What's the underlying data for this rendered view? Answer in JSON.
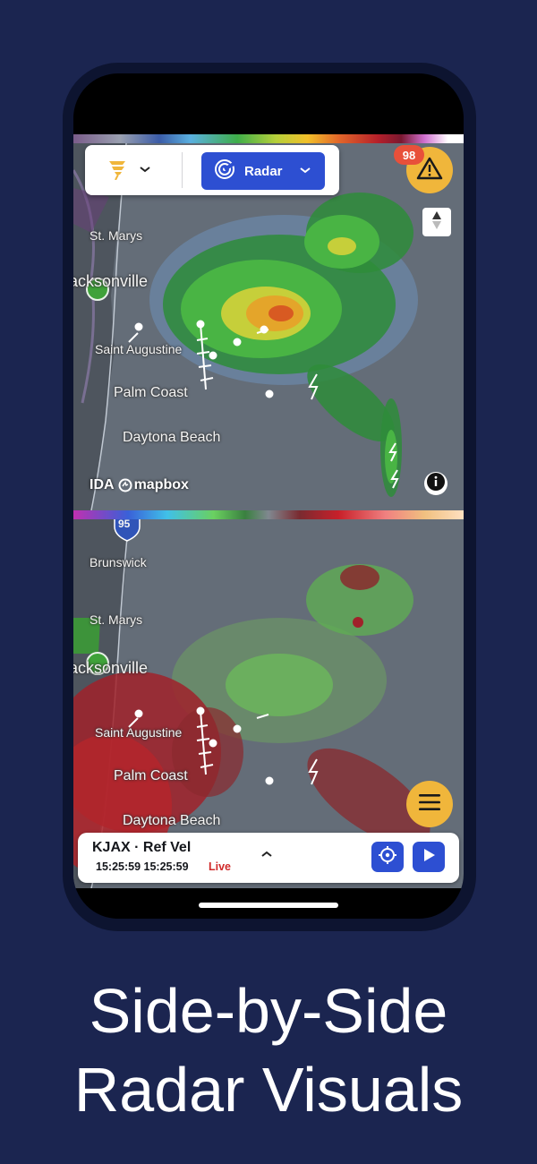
{
  "colors": {
    "background": "#1b2550",
    "accent_blue": "#2d4fd2",
    "alert_yellow": "#f0b63b",
    "badge_red": "#e8503a",
    "live_red": "#d02a2a",
    "city_marker_green": "#3fa23a"
  },
  "toolbar": {
    "layer_icon": "storm-layer-icon",
    "radar_icon": "radar-icon",
    "radar_label": "Radar"
  },
  "alerts": {
    "count": "98",
    "icon": "warning-triangle-icon"
  },
  "compass": {
    "icon": "compass-north-icon"
  },
  "info": {
    "icon": "info-icon"
  },
  "attribution": {
    "brand": "mapbox",
    "overlay_fragment": "IDA"
  },
  "map_top": {
    "cities": [
      "St. Marys",
      "Jacksonville",
      "Saint Augustine",
      "Palm Coast",
      "Daytona Beach",
      "Daytona"
    ]
  },
  "map_bottom": {
    "interstate_shield": "95",
    "cities": [
      "Brunswick",
      "St. Marys",
      "Jacksonville",
      "Saint Augustine",
      "Palm Coast",
      "Daytona Beach"
    ]
  },
  "menu": {
    "icon": "hamburger-menu-icon"
  },
  "bottom_panel": {
    "station": "KJAX · Ref Vel",
    "times": "15:25:59 15:25:59",
    "live": "Live",
    "expand_icon": "chevron-up-icon",
    "locate_icon": "crosshair-icon",
    "play_icon": "play-icon"
  },
  "headline": {
    "line1": "Side-by-Side",
    "line2": "Radar Visuals"
  }
}
